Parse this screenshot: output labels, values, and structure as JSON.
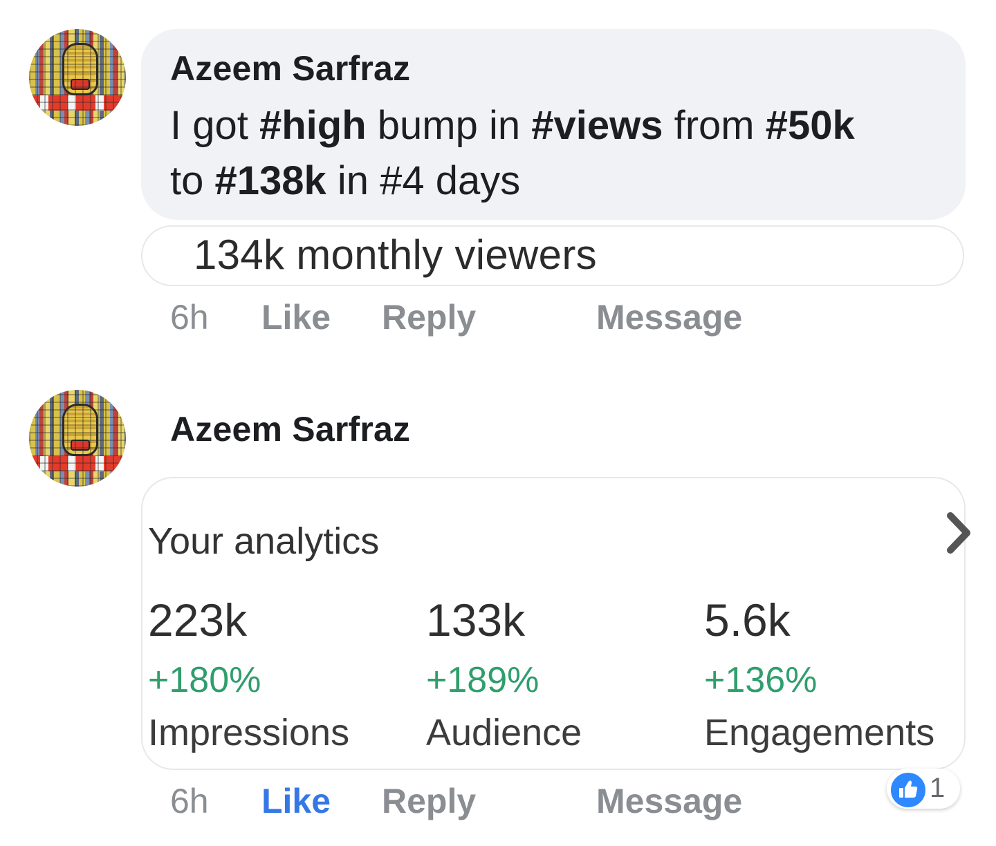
{
  "comments": [
    {
      "author": "Azeem Sarfraz",
      "text_parts": [
        {
          "t": "I got ",
          "b": false
        },
        {
          "t": "#high",
          "b": true
        },
        {
          "t": " bump in ",
          "b": false
        },
        {
          "t": "#views",
          "b": true
        },
        {
          "t": " from ",
          "b": false
        },
        {
          "t": "#50k",
          "b": true
        },
        {
          "t": " to ",
          "b": false
        },
        {
          "t": "#138k",
          "b": true
        },
        {
          "t": " in #4 days",
          "b": false
        }
      ],
      "attachment_text": "134k monthly viewers",
      "time": "6h",
      "like_label": "Like",
      "reply_label": "Reply",
      "message_label": "Message"
    },
    {
      "author": "Azeem Sarfraz",
      "analytics": {
        "title": "Your analytics",
        "metrics": [
          {
            "value": "223k",
            "change": "+180%",
            "label": "Impressions"
          },
          {
            "value": "133k",
            "change": "+189%",
            "label": "Audience"
          },
          {
            "value": "5.6k",
            "change": "+136%",
            "label": "Engagements"
          }
        ]
      },
      "time": "6h",
      "like_label": "Like",
      "reply_label": "Reply",
      "message_label": "Message",
      "reaction_count": "1",
      "liked": true
    }
  ],
  "colors": {
    "bubble": "#f0f2f5",
    "liked": "#3578e5",
    "positive": "#2f9e6d",
    "muted": "#8a8d91",
    "reaction": "#2e89ff"
  },
  "icons": {
    "chevron": "chevron-right-icon",
    "reaction": "thumbs-up-icon"
  }
}
